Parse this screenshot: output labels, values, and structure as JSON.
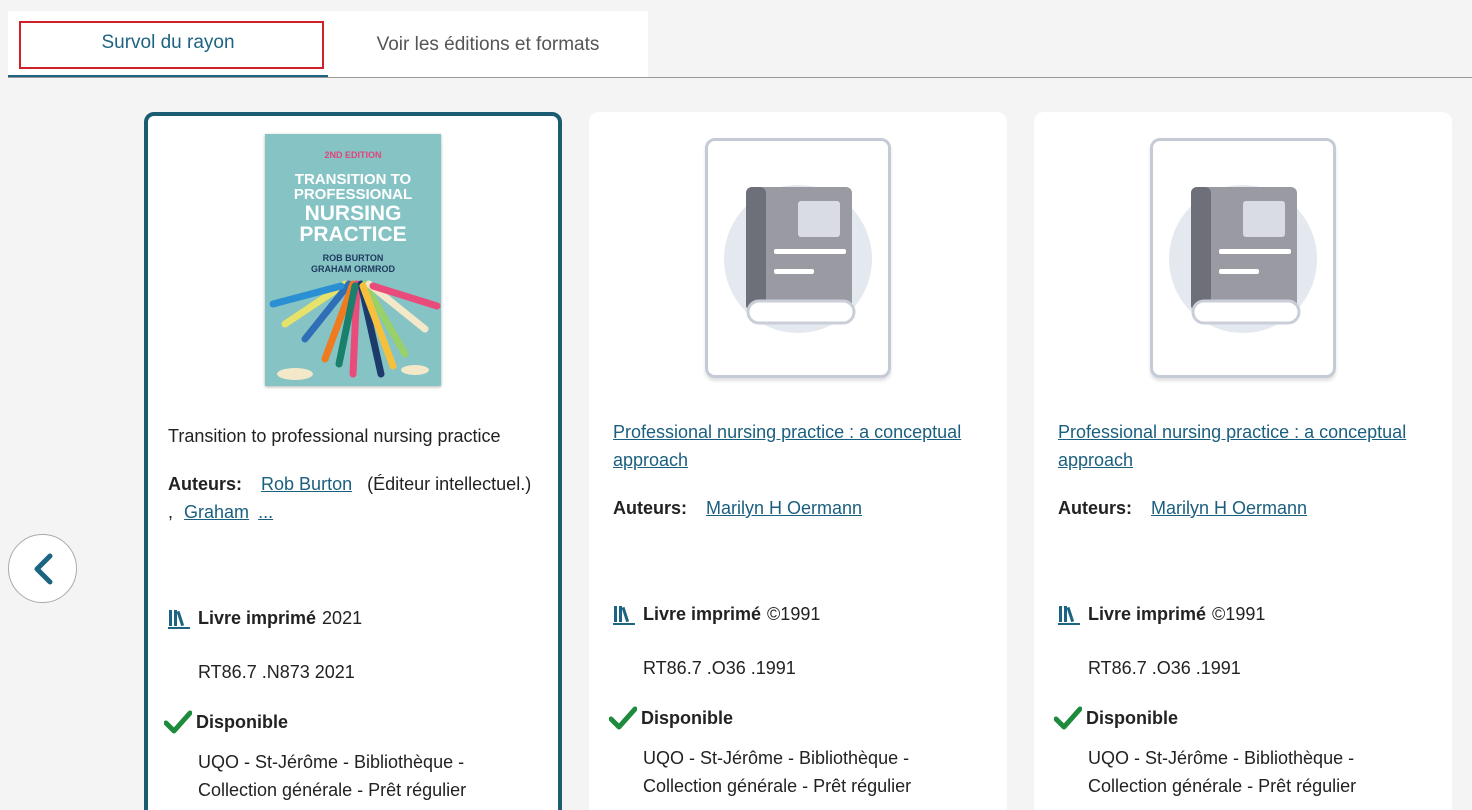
{
  "tabs": [
    {
      "label": "Survol du rayon",
      "active": true
    },
    {
      "label": "Voir les éditions et formats",
      "active": false
    }
  ],
  "cover": {
    "edition": "2ND EDITION",
    "title_lines": [
      "TRANSITION TO",
      "PROFESSIONAL",
      "NURSING",
      "PRACTICE"
    ],
    "authors": [
      "ROB BURTON",
      "GRAHAM ORMROD"
    ]
  },
  "labels": {
    "authors": "Auteurs:",
    "format": "Livre imprimé",
    "available": "Disponible"
  },
  "colors": {
    "accent": "#1d6482",
    "focus_outline": "#d0202a",
    "available": "#1e8a3c",
    "cover_bg": "#86c3c4"
  },
  "cards": [
    {
      "title": "Transition to professional nursing practice",
      "title_is_link": false,
      "author1": "Rob Burton",
      "author1_role": "(Éditeur intellectuel.) ,",
      "author2": "Graham",
      "more": "...",
      "year": "2021",
      "call_number": "RT86.7 .N873 2021",
      "location": "UQO - St-Jérôme - Bibliothèque - Collection générale - Prêt régulier",
      "icon": "book-cover"
    },
    {
      "title": "Professional nursing practice : a conceptual approach",
      "title_is_link": true,
      "author1": "Marilyn H Oermann",
      "year": "©1991",
      "call_number": "RT86.7 .O36 .1991",
      "location": "UQO - St-Jérôme - Bibliothèque - Collection générale - Prêt régulier",
      "icon": "book-placeholder-icon"
    },
    {
      "title": "Professional nursing practice : a conceptual approach",
      "title_is_link": true,
      "author1": "Marilyn H Oermann",
      "year": "©1991",
      "call_number": "RT86.7 .O36 .1991",
      "location": "UQO - St-Jérôme - Bibliothèque - Collection générale - Prêt régulier",
      "icon": "book-placeholder-icon"
    }
  ]
}
